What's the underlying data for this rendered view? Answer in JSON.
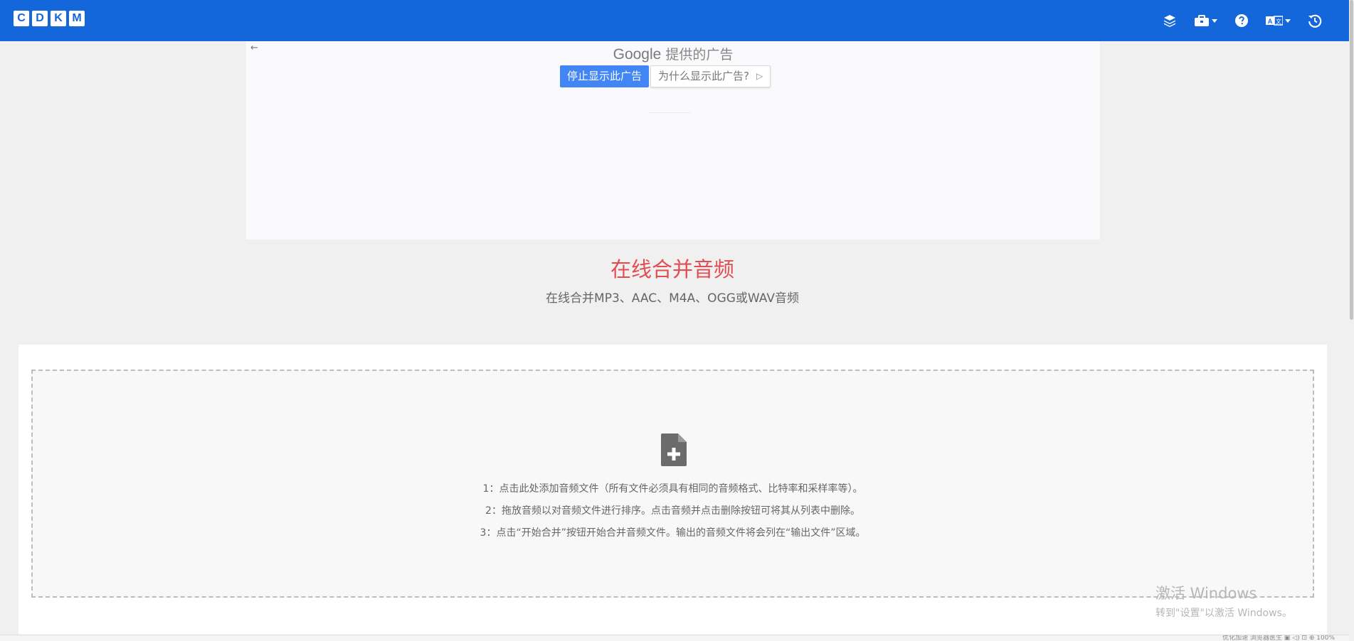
{
  "navbar": {
    "logo_letters": [
      "C",
      "D",
      "K",
      "M"
    ],
    "icons": [
      "layers-icon",
      "toolbox-icon",
      "help-icon",
      "translate-icon",
      "history-icon"
    ],
    "brand_color": "#1367db"
  },
  "ad": {
    "back_arrow": "←",
    "google": "Google",
    "provided": " 提供的广告",
    "stop_label": "停止显示此广告",
    "why_label": "为什么显示此广告?",
    "why_icon": "▷"
  },
  "main": {
    "title": "在线合并音频",
    "subtitle": "在线合并MP3、AAC、M4A、OGG或WAV音频",
    "title_color": "#e04e52",
    "dropzone": {
      "icon": "file-add-icon",
      "instructions": [
        "1：点击此处添加音频文件（所有文件必须具有相同的音频格式、比特率和采样率等）。",
        "2：拖放音频以对音频文件进行排序。点击音频并点击删除按钮可将其从列表中删除。",
        "3：点击“开始合并”按钮开始合并音频文件。输出的音频文件将会列在“输出文件”区域。"
      ]
    }
  },
  "watermark": {
    "title": "激活 Windows",
    "subtitle": "转到\"设置\"以激活 Windows。"
  },
  "statusbar": {
    "text": "优化加速    浏览器医生    ▣    ◁)    ⊡    ⊕ 100%"
  }
}
